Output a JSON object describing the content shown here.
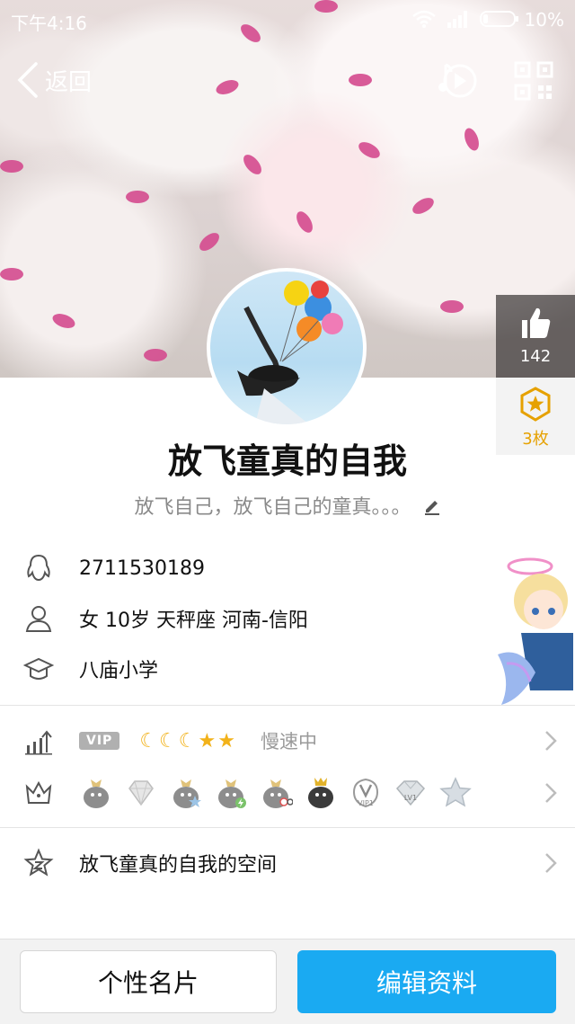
{
  "status_bar": {
    "time": "下午4:16",
    "battery": "10%"
  },
  "nav": {
    "back_label": "返回"
  },
  "profile": {
    "nickname": "放飞童真的自我",
    "signature": "放飞自己，放飞自己的童真。。。",
    "likes": "142",
    "gifts": "3枚"
  },
  "info": {
    "qq_number": "2711530189",
    "person": "女  10岁  天秤座  河南-信阳",
    "school": "八庙小学"
  },
  "level_row": {
    "vip_label": "VIP",
    "level_text": "慢速中",
    "moons": 3,
    "stars": 2
  },
  "badges": [
    "penguin-crown-icon",
    "diamond-icon",
    "penguin-star-icon",
    "penguin-lightning-icon",
    "penguin-glasses-icon",
    "penguin-gold-crown-icon",
    "vip1-icon",
    "lv1-icon",
    "star-badge-icon"
  ],
  "badge_texts": {
    "vip1": "VIP1",
    "lv1": "LV1"
  },
  "space": {
    "label": "放飞童真的自我的空间"
  },
  "buttons": {
    "card_label": "个性名片",
    "edit_label": "编辑资料"
  },
  "colors": {
    "accent": "#1aaaf2",
    "gift": "#e6a100",
    "petal": "#d44a8e"
  }
}
